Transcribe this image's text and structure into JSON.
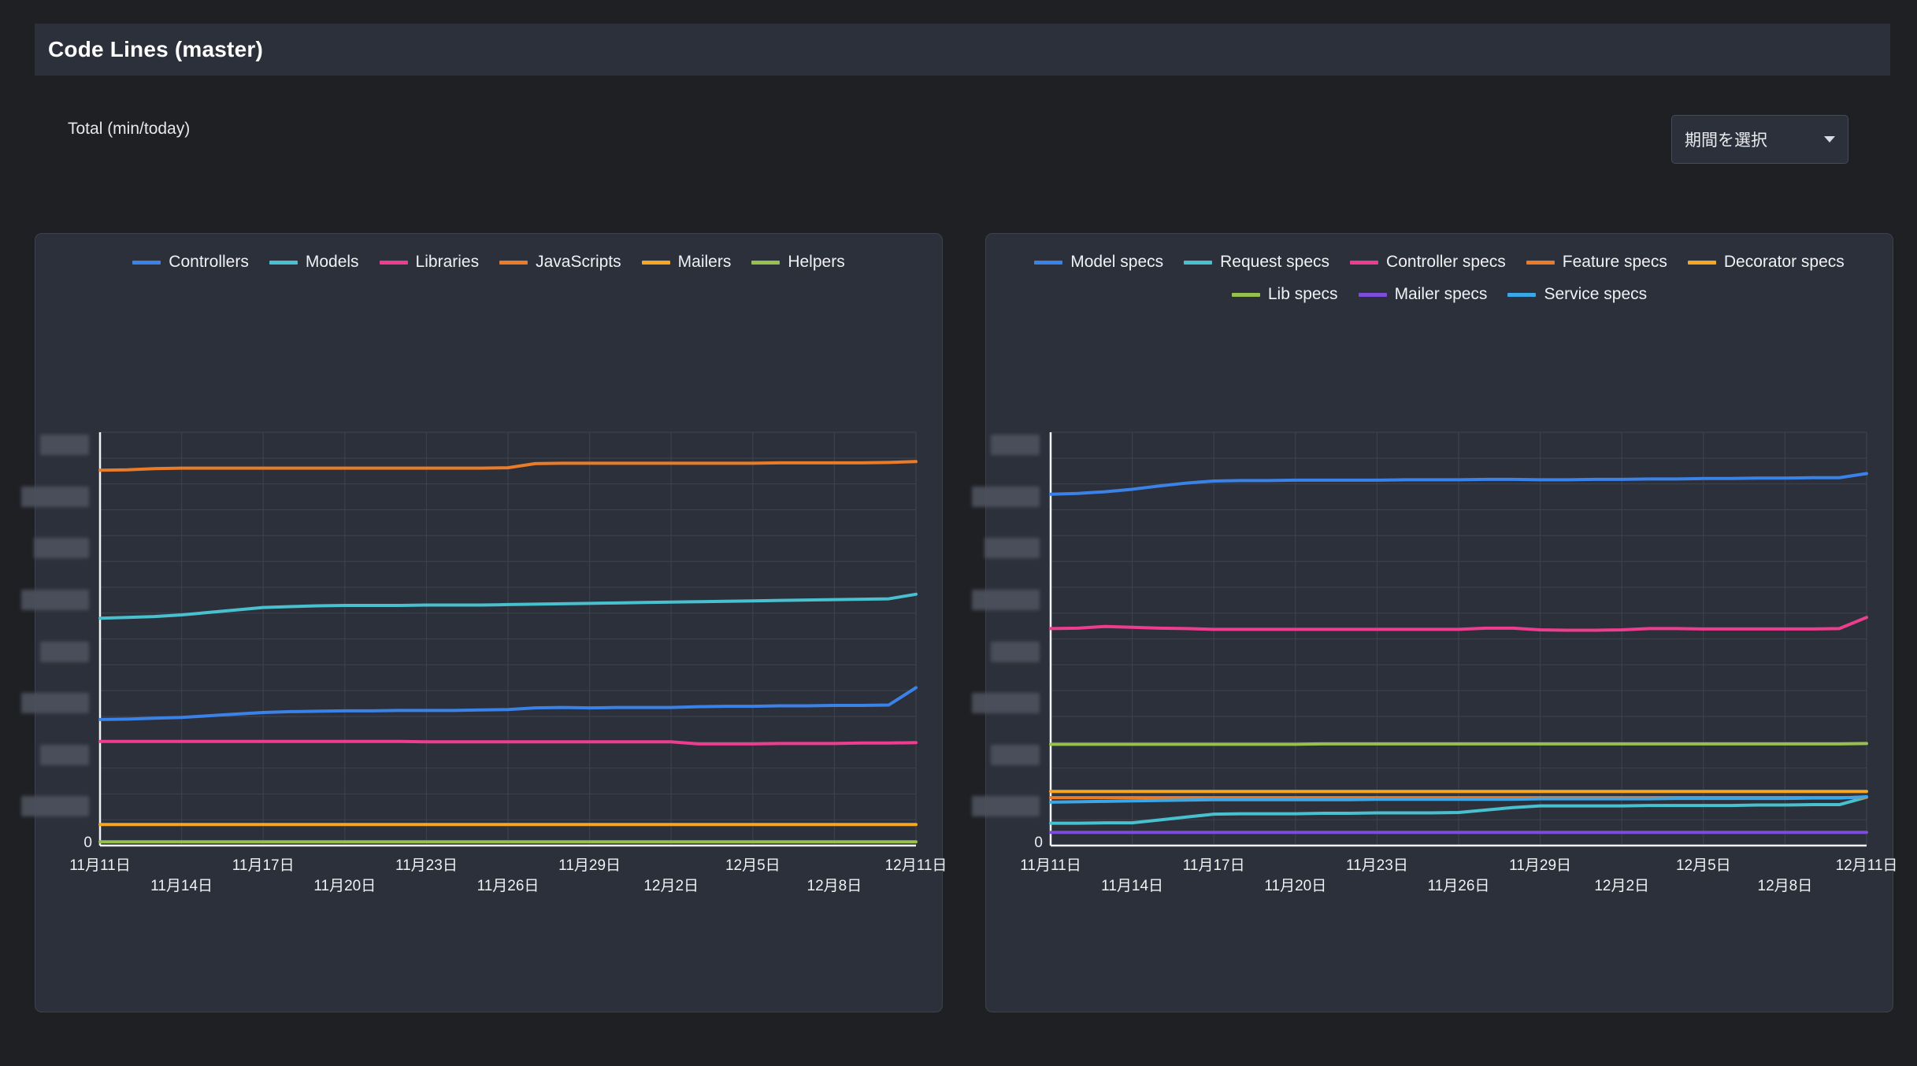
{
  "header": {
    "title": "Code Lines (master)"
  },
  "subbar": {
    "total_label": "Total (min/today)",
    "period_select": {
      "value": "期間を選択",
      "caret_icon": "chevron-down-icon"
    }
  },
  "colors": {
    "page_bg": "#1e2024",
    "card_bg": "#2c303a",
    "card_border": "#3c414d",
    "axis": "#f2f3f5",
    "grid": "#3e434e",
    "text": "#f0f1f4"
  },
  "x_axis": {
    "ticks": [
      "11月11日",
      "11月14日",
      "11月17日",
      "11月20日",
      "11月23日",
      "11月26日",
      "11月29日",
      "12月2日",
      "12月5日",
      "12月8日",
      "12月11日"
    ]
  },
  "y_axis": {
    "zero_label": "0",
    "masked_tick_count": 8,
    "note": "tick labels redacted"
  },
  "chart_data": [
    {
      "id": "code-lines-app",
      "type": "line",
      "title": "Code Lines (master)",
      "xlabel": "",
      "ylabel": "",
      "grid": true,
      "legend_position": "top",
      "x": [
        "11月11日",
        "11月12日",
        "11月13日",
        "11月14日",
        "11月15日",
        "11月16日",
        "11月17日",
        "11月18日",
        "11月19日",
        "11月20日",
        "11月21日",
        "11月22日",
        "11月23日",
        "11月24日",
        "11月25日",
        "11月26日",
        "11月27日",
        "11月28日",
        "11月29日",
        "11月30日",
        "12月1日",
        "12月2日",
        "12月3日",
        "12月4日",
        "12月5日",
        "12月6日",
        "12月7日",
        "12月8日",
        "12月9日",
        "12月10日",
        "12月11日"
      ],
      "ylim": [
        0,
        100
      ],
      "series": [
        {
          "name": "Controllers",
          "color": "#3b82e8",
          "values": [
            30.5,
            30.6,
            30.8,
            31.0,
            31.4,
            31.8,
            32.2,
            32.4,
            32.5,
            32.6,
            32.6,
            32.7,
            32.7,
            32.7,
            32.8,
            32.9,
            33.3,
            33.4,
            33.3,
            33.4,
            33.4,
            33.4,
            33.6,
            33.7,
            33.7,
            33.8,
            33.8,
            33.9,
            33.9,
            34.0,
            38.2
          ]
        },
        {
          "name": "Models",
          "color": "#48c0cf",
          "values": [
            55.0,
            55.2,
            55.4,
            55.8,
            56.4,
            57.0,
            57.6,
            57.8,
            58.0,
            58.1,
            58.1,
            58.1,
            58.2,
            58.2,
            58.2,
            58.3,
            58.4,
            58.5,
            58.6,
            58.7,
            58.8,
            58.9,
            59.0,
            59.1,
            59.2,
            59.3,
            59.4,
            59.5,
            59.6,
            59.7,
            60.8
          ]
        },
        {
          "name": "Libraries",
          "color": "#ee3d8f",
          "values": [
            25.2,
            25.2,
            25.2,
            25.2,
            25.2,
            25.2,
            25.2,
            25.2,
            25.2,
            25.2,
            25.2,
            25.2,
            25.1,
            25.1,
            25.1,
            25.1,
            25.1,
            25.1,
            25.1,
            25.1,
            25.1,
            25.1,
            24.6,
            24.6,
            24.6,
            24.7,
            24.7,
            24.7,
            24.8,
            24.8,
            24.9
          ]
        },
        {
          "name": "JavaScripts",
          "color": "#ea7b28",
          "values": [
            90.8,
            90.9,
            91.2,
            91.3,
            91.3,
            91.3,
            91.3,
            91.3,
            91.3,
            91.3,
            91.3,
            91.3,
            91.3,
            91.3,
            91.3,
            91.4,
            92.4,
            92.5,
            92.5,
            92.5,
            92.5,
            92.5,
            92.5,
            92.5,
            92.5,
            92.6,
            92.6,
            92.6,
            92.6,
            92.7,
            92.9
          ]
        },
        {
          "name": "Mailers",
          "color": "#f5a623",
          "values": [
            5.1,
            5.1,
            5.1,
            5.1,
            5.1,
            5.1,
            5.1,
            5.1,
            5.1,
            5.1,
            5.1,
            5.1,
            5.1,
            5.1,
            5.1,
            5.1,
            5.1,
            5.1,
            5.1,
            5.1,
            5.1,
            5.1,
            5.1,
            5.1,
            5.1,
            5.1,
            5.1,
            5.1,
            5.1,
            5.1,
            5.1
          ]
        },
        {
          "name": "Helpers",
          "color": "#97c04e",
          "values": [
            0.9,
            0.9,
            0.9,
            0.9,
            0.9,
            0.9,
            0.9,
            0.9,
            0.9,
            0.9,
            0.9,
            0.9,
            0.9,
            0.9,
            0.9,
            0.9,
            0.9,
            0.9,
            0.9,
            0.9,
            0.9,
            0.9,
            0.9,
            0.9,
            0.9,
            0.9,
            0.9,
            0.9,
            0.9,
            0.9,
            0.9
          ]
        }
      ]
    },
    {
      "id": "code-lines-specs",
      "type": "line",
      "title": "Code Lines (master) — specs",
      "xlabel": "",
      "ylabel": "",
      "grid": true,
      "legend_position": "top",
      "x": [
        "11月11日",
        "11月12日",
        "11月13日",
        "11月14日",
        "11月15日",
        "11月16日",
        "11月17日",
        "11月18日",
        "11月19日",
        "11月20日",
        "11月21日",
        "11月22日",
        "11月23日",
        "11月24日",
        "11月25日",
        "11月26日",
        "11月27日",
        "11月28日",
        "11月29日",
        "11月30日",
        "12月1日",
        "12月2日",
        "12月3日",
        "12月4日",
        "12月5日",
        "12月6日",
        "12月7日",
        "12月8日",
        "12月9日",
        "12月10日",
        "12月11日"
      ],
      "ylim": [
        0,
        100
      ],
      "series": [
        {
          "name": "Model specs",
          "color": "#3b82e8",
          "values": [
            85.0,
            85.2,
            85.6,
            86.2,
            87.0,
            87.7,
            88.2,
            88.3,
            88.3,
            88.4,
            88.4,
            88.4,
            88.4,
            88.5,
            88.5,
            88.5,
            88.6,
            88.6,
            88.5,
            88.5,
            88.6,
            88.6,
            88.7,
            88.7,
            88.8,
            88.8,
            88.9,
            88.9,
            89.0,
            89.0,
            90.0
          ]
        },
        {
          "name": "Request specs",
          "color": "#48c0cf",
          "values": [
            5.4,
            5.4,
            5.5,
            5.5,
            6.2,
            6.9,
            7.6,
            7.7,
            7.7,
            7.7,
            7.8,
            7.8,
            7.9,
            7.9,
            7.9,
            8.0,
            8.6,
            9.2,
            9.6,
            9.6,
            9.6,
            9.6,
            9.7,
            9.7,
            9.7,
            9.7,
            9.8,
            9.8,
            9.9,
            9.9,
            11.7
          ]
        },
        {
          "name": "Controller specs",
          "color": "#ee3d8f",
          "values": [
            52.5,
            52.6,
            53.0,
            52.8,
            52.6,
            52.5,
            52.3,
            52.3,
            52.3,
            52.3,
            52.3,
            52.3,
            52.3,
            52.3,
            52.3,
            52.3,
            52.6,
            52.6,
            52.2,
            52.1,
            52.1,
            52.2,
            52.5,
            52.5,
            52.4,
            52.4,
            52.4,
            52.4,
            52.4,
            52.5,
            55.2
          ]
        },
        {
          "name": "Feature specs",
          "color": "#ea7b28",
          "values": [
            11.6,
            11.6,
            11.6,
            11.6,
            11.6,
            11.6,
            11.6,
            11.6,
            11.6,
            11.6,
            11.6,
            11.6,
            11.6,
            11.6,
            11.6,
            11.6,
            11.6,
            11.6,
            11.6,
            11.6,
            11.6,
            11.6,
            11.6,
            11.6,
            11.6,
            11.6,
            11.6,
            11.6,
            11.6,
            11.6,
            11.7
          ]
        },
        {
          "name": "Decorator specs",
          "color": "#f5a623",
          "values": [
            13.1,
            13.1,
            13.1,
            13.1,
            13.1,
            13.1,
            13.1,
            13.1,
            13.1,
            13.1,
            13.1,
            13.1,
            13.1,
            13.1,
            13.1,
            13.1,
            13.1,
            13.1,
            13.1,
            13.1,
            13.1,
            13.1,
            13.1,
            13.1,
            13.1,
            13.1,
            13.1,
            13.1,
            13.1,
            13.1,
            13.1
          ]
        },
        {
          "name": "Lib specs",
          "color": "#97c04e",
          "values": [
            24.5,
            24.5,
            24.5,
            24.5,
            24.5,
            24.5,
            24.5,
            24.5,
            24.5,
            24.5,
            24.6,
            24.6,
            24.6,
            24.6,
            24.6,
            24.6,
            24.6,
            24.6,
            24.6,
            24.6,
            24.6,
            24.6,
            24.6,
            24.6,
            24.6,
            24.6,
            24.6,
            24.6,
            24.6,
            24.6,
            24.7
          ]
        },
        {
          "name": "Mailer specs",
          "color": "#7c4ddb",
          "values": [
            3.2,
            3.2,
            3.2,
            3.2,
            3.2,
            3.2,
            3.2,
            3.2,
            3.2,
            3.2,
            3.2,
            3.2,
            3.2,
            3.2,
            3.2,
            3.2,
            3.2,
            3.2,
            3.2,
            3.2,
            3.2,
            3.2,
            3.2,
            3.2,
            3.2,
            3.2,
            3.2,
            3.2,
            3.2,
            3.2,
            3.2
          ]
        },
        {
          "name": "Service specs",
          "color": "#3aa7e8",
          "values": [
            10.5,
            10.6,
            10.7,
            10.8,
            10.9,
            11.0,
            11.1,
            11.1,
            11.1,
            11.1,
            11.1,
            11.1,
            11.2,
            11.2,
            11.2,
            11.2,
            11.2,
            11.2,
            11.3,
            11.3,
            11.3,
            11.3,
            11.3,
            11.4,
            11.4,
            11.4,
            11.4,
            11.4,
            11.5,
            11.5,
            11.8
          ]
        }
      ]
    }
  ]
}
